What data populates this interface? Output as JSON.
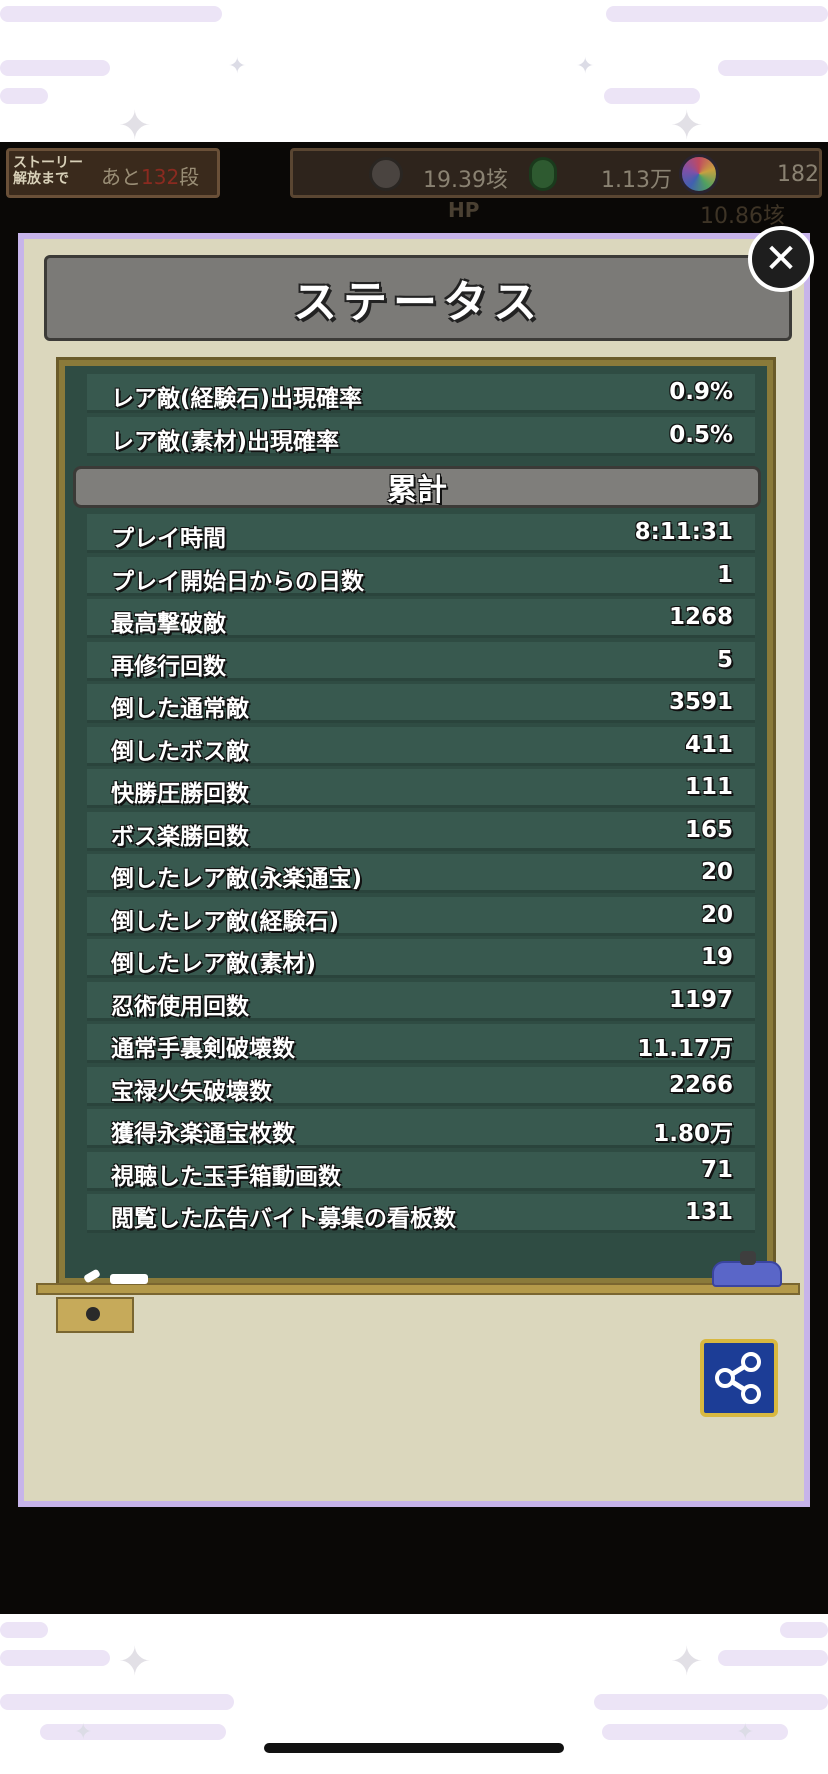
{
  "hud": {
    "story_label_line1": "ストーリー",
    "story_label_line2": "解放まで",
    "story_remain_prefix": "あと",
    "story_remain_number": "132",
    "story_remain_suffix": "段",
    "resources": [
      {
        "icon": "coin-icon",
        "value": "19.39垓",
        "color": "#4a4440"
      },
      {
        "icon": "green-gem-icon",
        "value": "1.13万",
        "color": "#2e5a30"
      },
      {
        "icon": "rainbow-gem-icon",
        "value": "182",
        "color": "#7060a8"
      }
    ],
    "hp_label": "HP",
    "hp_value": "10.86垓"
  },
  "panel": {
    "title": "ステータス",
    "close_icon": "close-icon",
    "share_icon": "share-icon"
  },
  "stats_top": [
    {
      "label": "レア敵(経験石)出現確率",
      "value": "0.9%"
    },
    {
      "label": "レア敵(素材)出現確率",
      "value": "0.5%"
    }
  ],
  "section": {
    "title": "累計"
  },
  "stats_total": [
    {
      "label": "プレイ時間",
      "value": "8:11:31"
    },
    {
      "label": "プレイ開始日からの日数",
      "value": "1"
    },
    {
      "label": "最高撃破敵",
      "value": "1268"
    },
    {
      "label": "再修行回数",
      "value": "5"
    },
    {
      "label": "倒した通常敵",
      "value": "3591"
    },
    {
      "label": "倒したボス敵",
      "value": "411"
    },
    {
      "label": "快勝圧勝回数",
      "value": "111"
    },
    {
      "label": "ボス楽勝回数",
      "value": "165"
    },
    {
      "label": "倒したレア敵(永楽通宝)",
      "value": "20"
    },
    {
      "label": "倒したレア敵(経験石)",
      "value": "20"
    },
    {
      "label": "倒したレア敵(素材)",
      "value": "19"
    },
    {
      "label": "忍術使用回数",
      "value": "1197"
    },
    {
      "label": "通常手裏剣破壊数",
      "value": "11.17万"
    },
    {
      "label": "宝禄火矢破壊数",
      "value": "2266"
    },
    {
      "label": "獲得永楽通宝枚数",
      "value": "1.80万"
    },
    {
      "label": "視聴した玉手箱動画数",
      "value": "71"
    },
    {
      "label": "閲覧した広告バイト募集の看板数",
      "value": "131"
    }
  ]
}
